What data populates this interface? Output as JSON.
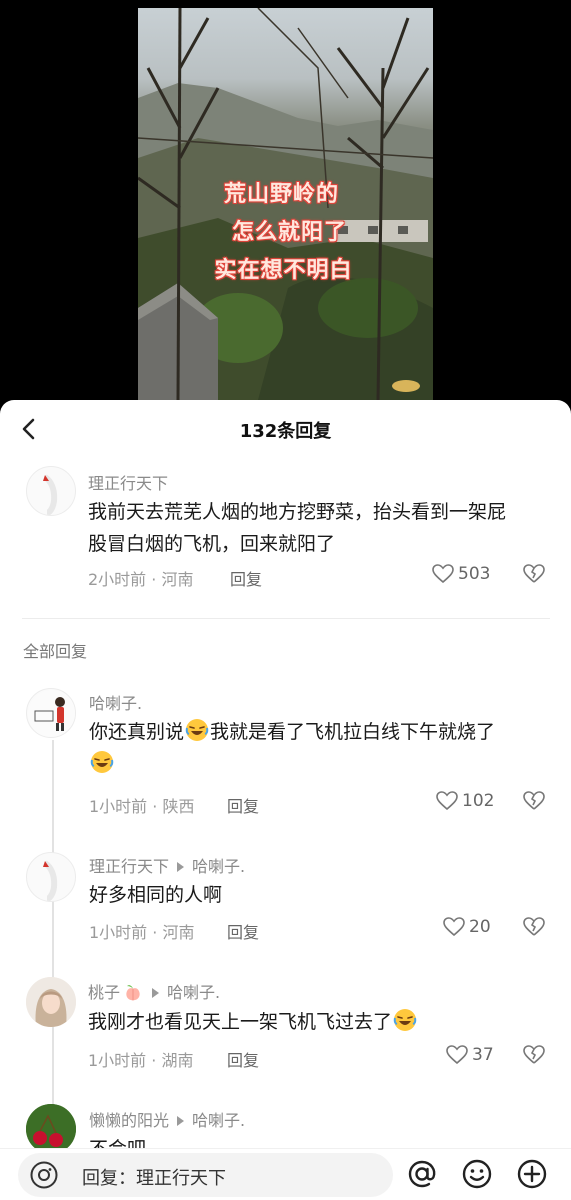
{
  "video": {
    "overlay_lines": [
      "荒山野岭的",
      "怎么就阳了",
      "实在想不明白"
    ]
  },
  "header": {
    "back_icon": "chevron-left-icon",
    "title": "132条回复"
  },
  "main_comment": {
    "username": "理正行天下",
    "text_line1": "我前天去荒芜人烟的地方挖野菜，抬头看到一架屁",
    "text_line2": "股冒白烟的飞机，回来就阳了",
    "time": "2小时前",
    "dot": "·",
    "location": "河南",
    "reply_label": "回复",
    "likes": "503"
  },
  "section_label": "全部回复",
  "replies": [
    {
      "username": "哈喇子.",
      "reply_to": "",
      "text_a": "你还真别说",
      "text_b": "我就是看了飞机拉白线下午就烧了",
      "time": "1小时前",
      "dot": "·",
      "location": "陕西",
      "reply_label": "回复",
      "likes": "102"
    },
    {
      "username": "理正行天下",
      "reply_to": "哈喇子.",
      "text": "好多相同的人啊",
      "time": "1小时前",
      "dot": "·",
      "location": "河南",
      "reply_label": "回复",
      "likes": "20"
    },
    {
      "username": "桃子",
      "reply_to": "哈喇子.",
      "text": "我刚才也看见天上一架飞机飞过去了",
      "time": "1小时前",
      "dot": "·",
      "location": "湖南",
      "reply_label": "回复",
      "likes": "37"
    },
    {
      "username": "懒懒的阳光",
      "reply_to": "哈喇子.",
      "text_partial": "不会吧"
    }
  ],
  "input_bar": {
    "placeholder": "回复：理正行天下",
    "camera_icon": "camera-icon",
    "at_icon": "at-icon",
    "emoji_icon": "smile-icon",
    "add_icon": "plus-icon"
  },
  "colors": {
    "overlay_text": "#ffe8de",
    "overlay_stroke": "#e0443a",
    "meta_gray": "#9a9a9a",
    "laugh_emoji": "#ffc83d"
  }
}
